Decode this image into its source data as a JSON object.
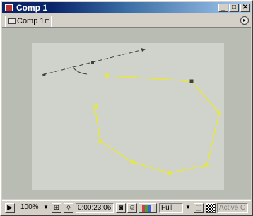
{
  "window": {
    "title": "Comp 1",
    "controls": {
      "minimize": "_",
      "maximize": "□",
      "close": "✕"
    }
  },
  "tabs": [
    {
      "label": "Comp 1",
      "active": true
    }
  ],
  "panel_menu_icon": "▸",
  "viewport": {
    "canvas_color": "#cfd3cb",
    "pasteboard_color": "#b8bcb3",
    "motion_path_color": "#404040",
    "mask_path_color": "#f0f000"
  },
  "toolbar": {
    "magnification": "100%",
    "magnification_arrow": "▼",
    "timecode": "0:00:23:06",
    "resolution": "Full",
    "resolution_arrow": "▼",
    "active_camera": "Active C",
    "rgb_swatch_colors": [
      "#d04040",
      "#40a040",
      "#4060d0",
      "#e0e0e0"
    ]
  }
}
